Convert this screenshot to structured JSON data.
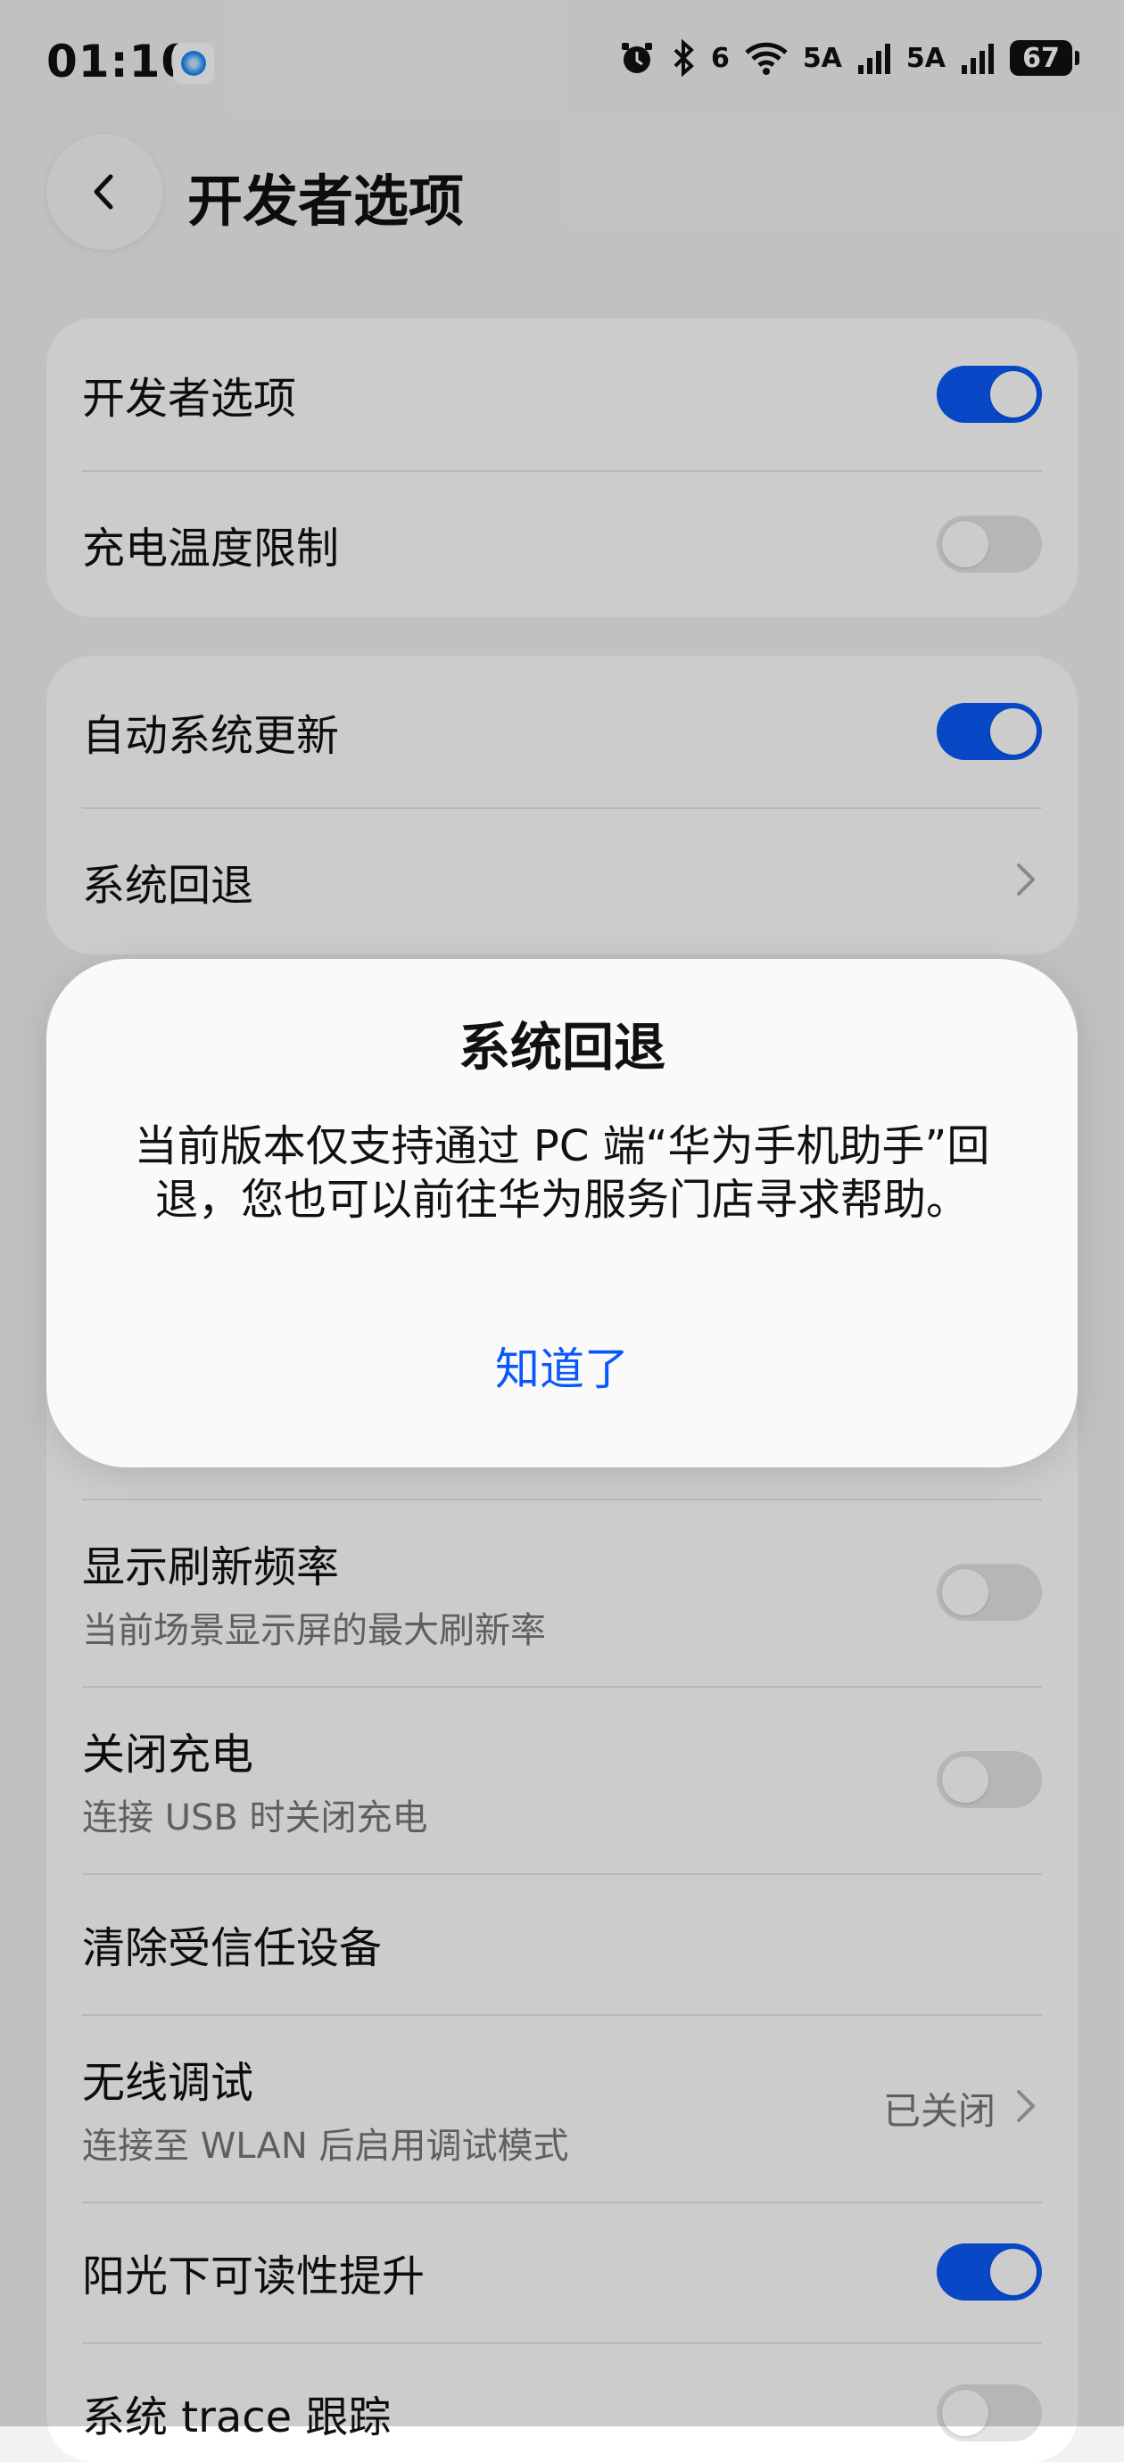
{
  "status_bar": {
    "time": "01:10",
    "wifi_badge": "6",
    "signal1": "5A",
    "signal2": "5A",
    "battery": "67"
  },
  "header": {
    "title": "开发者选项"
  },
  "card1": [
    {
      "label": "开发者选项",
      "toggle": true
    },
    {
      "label": "充电温度限制",
      "toggle": false
    }
  ],
  "card2": [
    {
      "label": "自动系统更新",
      "toggle": true
    },
    {
      "label": "系统回退"
    }
  ],
  "card3": {
    "refresh": {
      "label": "显示刷新频率",
      "sub": "当前场景显示屏的最大刷新率",
      "toggle": false
    },
    "charge": {
      "label": "关闭充电",
      "sub": "连接 USB 时关闭充电",
      "toggle": false
    },
    "trusted": {
      "label": "清除受信任设备"
    },
    "wireless": {
      "label": "无线调试",
      "sub": "连接至 WLAN 后启用调试模式",
      "value": "已关闭"
    },
    "sunlight": {
      "label": "阳光下可读性提升",
      "toggle": true
    },
    "trace": {
      "label": "系统 trace 跟踪",
      "toggle": false
    }
  },
  "dialog": {
    "title": "系统回退",
    "body": "当前版本仅支持通过 PC 端“华为手机助手”回退，您也可以前往华为服务门店寻求帮助。",
    "button": "知道了"
  },
  "colors": {
    "accent": "#0a59f7",
    "toggle_off": "#e3e4e6",
    "background": "#f1f2f4"
  }
}
